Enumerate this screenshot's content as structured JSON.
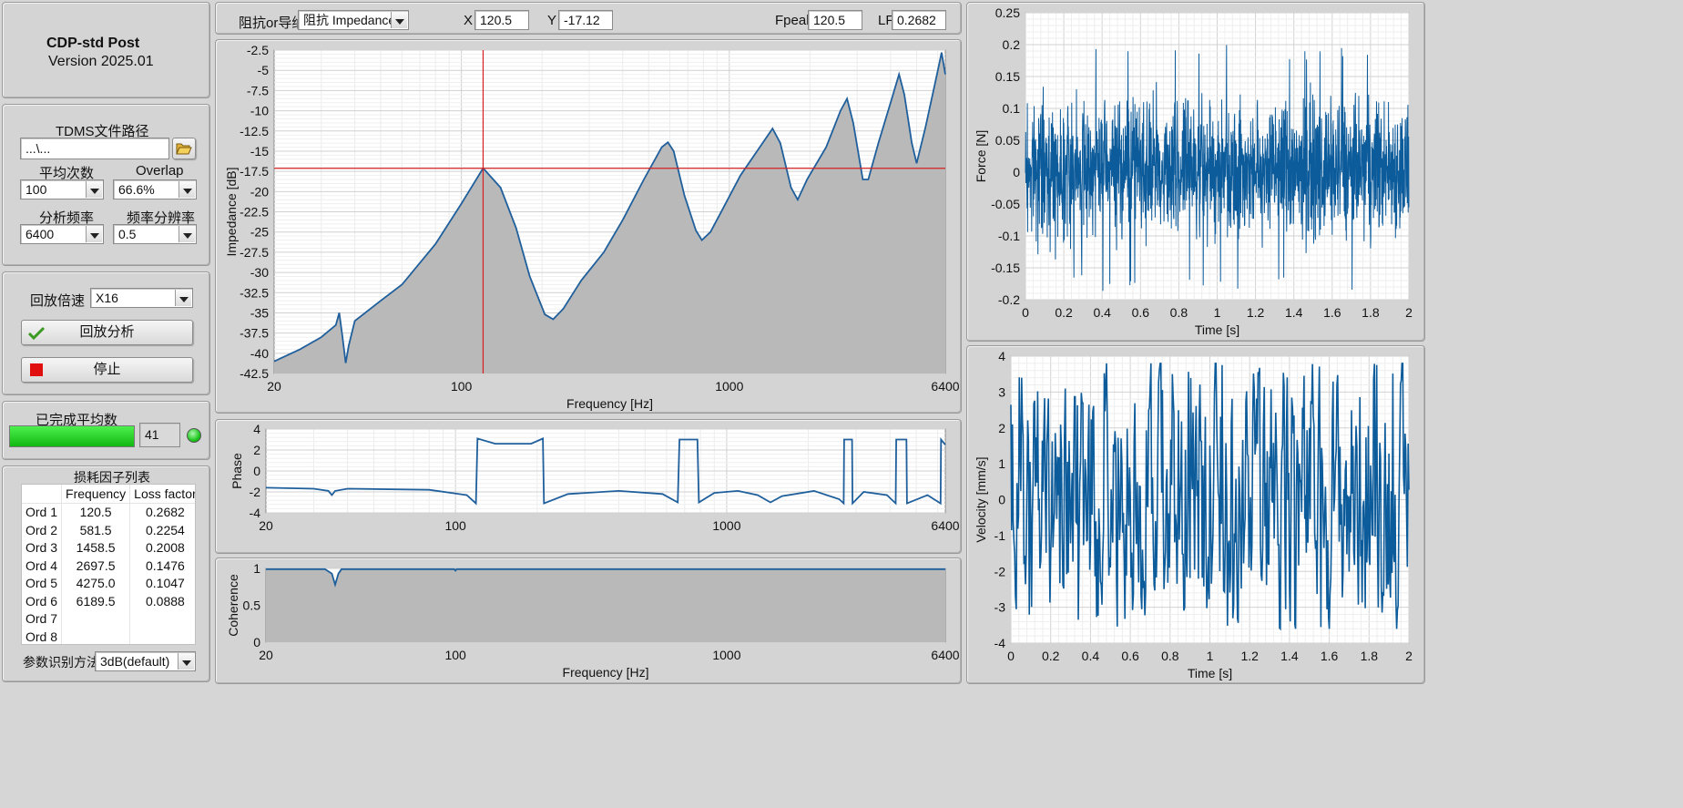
{
  "app": {
    "title": "CDP-std Post",
    "version": "Version 2025.01"
  },
  "file": {
    "path_label": "TDMS文件路径",
    "path_value": "...\\...",
    "browse_icon": "folder-open-icon"
  },
  "settings": {
    "averages_label": "平均次数",
    "averages_value": "100",
    "overlap_label": "Overlap",
    "overlap_value": "66.6%",
    "freq_label": "分析频率",
    "freq_value": "6400",
    "resolution_label": "频率分辨率",
    "resolution_value": "0.5"
  },
  "playback": {
    "speed_label": "回放倍速",
    "speed_value": "X16",
    "analyze_label": "回放分析",
    "stop_label": "停止"
  },
  "progress": {
    "label": "已完成平均数",
    "fill_fraction": 1.0,
    "count": "41",
    "bar_color": "#19d119",
    "led_color": "#1ec81e"
  },
  "loss_table": {
    "title": "损耗因子列表",
    "headers": [
      "",
      "Frequency",
      "Loss factor"
    ],
    "rows": [
      [
        "Ord 1",
        "120.5",
        "0.2682"
      ],
      [
        "Ord 2",
        "581.5",
        "0.2254"
      ],
      [
        "Ord 3",
        "1458.5",
        "0.2008"
      ],
      [
        "Ord 4",
        "2697.5",
        "0.1476"
      ],
      [
        "Ord 5",
        "4275.0",
        "0.1047"
      ],
      [
        "Ord 6",
        "6189.5",
        "0.0888"
      ],
      [
        "Ord 7",
        "",
        ""
      ],
      [
        "Ord 8",
        "",
        ""
      ]
    ],
    "method_label": "参数识别方法",
    "method_value": "3dB(default)"
  },
  "toolbar": {
    "mode_label": "阻抗or导纳",
    "mode_value": "阻抗 Impedance",
    "x_label": "X",
    "x_value": "120.5",
    "y_label": "Y",
    "y_value": "-17.12",
    "fpeak_label": "Fpeak",
    "fpeak_value": "120.5",
    "lf_label": "LF",
    "lf_value": "0.2682"
  },
  "colors": {
    "curve": "#1f5f9c",
    "fill": "#b9b9b9",
    "cursor": "#d42020",
    "noise": "#0c5b9b"
  },
  "chart_data": [
    {
      "id": "impedance",
      "type": "area",
      "xlabel": "Frequency [Hz]",
      "ylabel": "Impedance [dB]",
      "xscale": "log",
      "xlim": [
        20,
        6400
      ],
      "ylim": [
        -42.5,
        -2.5
      ],
      "xticks": [
        "20",
        "100",
        "1000",
        "6400"
      ],
      "yticks": [
        "-2.5",
        "-5",
        "-7.5",
        "-10",
        "-12.5",
        "-15",
        "-17.5",
        "-20",
        "-22.5",
        "-25",
        "-27.5",
        "-30",
        "-32.5",
        "-35",
        "-37.5",
        "-40",
        "-42.5"
      ],
      "cursor": {
        "x": 120.5,
        "y": -17.12
      },
      "points": [
        [
          20,
          -41
        ],
        [
          25,
          -39.5
        ],
        [
          30,
          -38
        ],
        [
          34,
          -36.5
        ],
        [
          35,
          -35
        ],
        [
          36,
          -38
        ],
        [
          37,
          -41.2
        ],
        [
          38,
          -39
        ],
        [
          40,
          -36
        ],
        [
          50,
          -33.5
        ],
        [
          60,
          -31.5
        ],
        [
          80,
          -26.5
        ],
        [
          100,
          -21.5
        ],
        [
          120.5,
          -17.1
        ],
        [
          140,
          -19.5
        ],
        [
          160,
          -24.5
        ],
        [
          180,
          -30.5
        ],
        [
          205,
          -35.2
        ],
        [
          220,
          -35.8
        ],
        [
          240,
          -34.5
        ],
        [
          280,
          -31
        ],
        [
          340,
          -27.5
        ],
        [
          400,
          -23.5
        ],
        [
          480,
          -18.5
        ],
        [
          560,
          -14.5
        ],
        [
          590,
          -13.9
        ],
        [
          620,
          -15
        ],
        [
          680,
          -20.5
        ],
        [
          750,
          -24.8
        ],
        [
          790,
          -26
        ],
        [
          850,
          -25
        ],
        [
          950,
          -22
        ],
        [
          1100,
          -18
        ],
        [
          1300,
          -14.5
        ],
        [
          1450,
          -12.2
        ],
        [
          1550,
          -14
        ],
        [
          1700,
          -19.5
        ],
        [
          1800,
          -21
        ],
        [
          1950,
          -18.5
        ],
        [
          2300,
          -14.5
        ],
        [
          2600,
          -10
        ],
        [
          2750,
          -8.5
        ],
        [
          2900,
          -11.5
        ],
        [
          3150,
          -18.5
        ],
        [
          3300,
          -18.5
        ],
        [
          3600,
          -14
        ],
        [
          4000,
          -9
        ],
        [
          4300,
          -5.5
        ],
        [
          4500,
          -8
        ],
        [
          4800,
          -14
        ],
        [
          5000,
          -16.5
        ],
        [
          5400,
          -12
        ],
        [
          6000,
          -5
        ],
        [
          6200,
          -2.8
        ],
        [
          6400,
          -5.5
        ]
      ]
    },
    {
      "id": "phase",
      "type": "line",
      "xlabel": "",
      "ylabel": "Phase",
      "xscale": "log",
      "xlim": [
        20,
        6400
      ],
      "ylim": [
        -4,
        4
      ],
      "xticks": [
        "20",
        "100",
        "1000",
        "6400"
      ],
      "yticks": [
        "4",
        "2",
        "0",
        "-2",
        "-4"
      ],
      "points": [
        [
          20,
          -1.6
        ],
        [
          30,
          -1.7
        ],
        [
          34,
          -1.9
        ],
        [
          35,
          -2.3
        ],
        [
          36,
          -1.9
        ],
        [
          40,
          -1.7
        ],
        [
          80,
          -1.8
        ],
        [
          110,
          -2.3
        ],
        [
          119,
          -3.1
        ],
        [
          120.5,
          3.1
        ],
        [
          140,
          2.6
        ],
        [
          190,
          2.6
        ],
        [
          210,
          3.1
        ],
        [
          212,
          -3.1
        ],
        [
          260,
          -2.2
        ],
        [
          400,
          -1.9
        ],
        [
          580,
          -2.2
        ],
        [
          660,
          -3.0
        ],
        [
          670,
          3.0
        ],
        [
          780,
          3.0
        ],
        [
          790,
          -3.0
        ],
        [
          900,
          -2.1
        ],
        [
          1100,
          -1.9
        ],
        [
          1300,
          -2.3
        ],
        [
          1450,
          -3.0
        ],
        [
          1600,
          -2.4
        ],
        [
          2100,
          -1.9
        ],
        [
          2600,
          -2.7
        ],
        [
          2700,
          -3.1
        ],
        [
          2710,
          3.0
        ],
        [
          2900,
          3.0
        ],
        [
          2910,
          -3.1
        ],
        [
          3200,
          -2.0
        ],
        [
          3900,
          -2.3
        ],
        [
          4200,
          -3.1
        ],
        [
          4220,
          3.0
        ],
        [
          4600,
          3.0
        ],
        [
          4620,
          -3.1
        ],
        [
          5500,
          -2.3
        ],
        [
          6150,
          -3.1
        ],
        [
          6170,
          3.0
        ],
        [
          6400,
          2.5
        ]
      ]
    },
    {
      "id": "coherence",
      "type": "area",
      "xlabel": "Frequency [Hz]",
      "ylabel": "Coherence",
      "xscale": "log",
      "xlim": [
        20,
        6400
      ],
      "ylim": [
        0,
        1
      ],
      "xticks": [
        "20",
        "100",
        "1000",
        "6400"
      ],
      "yticks": [
        "1",
        "0.5",
        "0"
      ],
      "points": [
        [
          20,
          0.99
        ],
        [
          33,
          0.99
        ],
        [
          35,
          0.93
        ],
        [
          36,
          0.78
        ],
        [
          37,
          0.93
        ],
        [
          38,
          0.99
        ],
        [
          99,
          0.99
        ],
        [
          100,
          0.97
        ],
        [
          101,
          0.99
        ],
        [
          6400,
          0.99
        ]
      ]
    },
    {
      "id": "force",
      "type": "line",
      "xlabel": "Time [s]",
      "ylabel": "Force [N]",
      "xlim": [
        0,
        2
      ],
      "ylim": [
        -0.2,
        0.25
      ],
      "xticks": [
        "0",
        "0.2",
        "0.4",
        "0.6",
        "0.8",
        "1",
        "1.2",
        "1.4",
        "1.6",
        "1.8",
        "2"
      ],
      "yticks": [
        "0.25",
        "0.2",
        "0.15",
        "0.1",
        "0.05",
        "0",
        "-0.05",
        "-0.1",
        "-0.15",
        "-0.2"
      ],
      "signal_range": [
        -0.19,
        0.2
      ]
    },
    {
      "id": "velocity",
      "type": "line",
      "xlabel": "Time [s]",
      "ylabel": "Velocity [mm/s]",
      "xlim": [
        0,
        2
      ],
      "ylim": [
        -4,
        4
      ],
      "xticks": [
        "0",
        "0.2",
        "0.4",
        "0.6",
        "0.8",
        "1",
        "1.2",
        "1.4",
        "1.6",
        "1.8",
        "2"
      ],
      "yticks": [
        "4",
        "3",
        "2",
        "1",
        "0",
        "-1",
        "-2",
        "-3",
        "-4"
      ],
      "signal_range": [
        -3.6,
        3.8
      ]
    }
  ]
}
